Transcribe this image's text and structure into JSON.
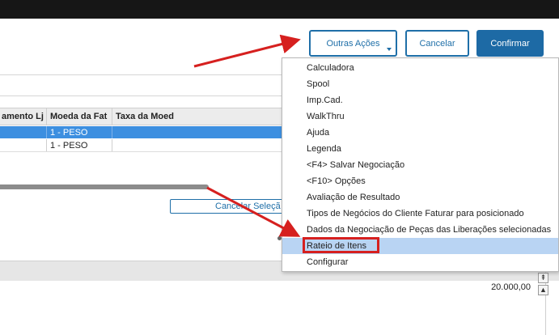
{
  "toolbar": {
    "outras_acoes_label": "Outras Ações",
    "cancelar_label": "Cancelar",
    "confirmar_label": "Confirmar"
  },
  "grid": {
    "columns": [
      "amento Lj",
      "Moeda da Fat",
      "Taxa da Moed"
    ],
    "rows": [
      [
        "",
        "1 - PESO",
        ""
      ],
      [
        "",
        "1 - PESO",
        ""
      ]
    ]
  },
  "cancel_selection_label": "Cancelar Seleçã",
  "value_display": "20.000,00",
  "dropdown_menu": {
    "items": [
      "Calculadora",
      "Spool",
      "Imp.Cad.",
      "WalkThru",
      "Ajuda",
      "Legenda",
      "<F4> Salvar Negociação",
      "<F10> Opções",
      "Avaliação de Resultado",
      "Tipos de Negócios do Cliente Faturar para posicionado",
      "Dados da Negociação de Peças das Liberações selecionadas",
      "Rateio de Itens",
      "Configurar"
    ],
    "highlighted_item": "Rateio de Itens"
  },
  "annotation_color": "#d6201f",
  "accent_color": "#1d6aa5",
  "selected_row_color": "#3d8fe0"
}
